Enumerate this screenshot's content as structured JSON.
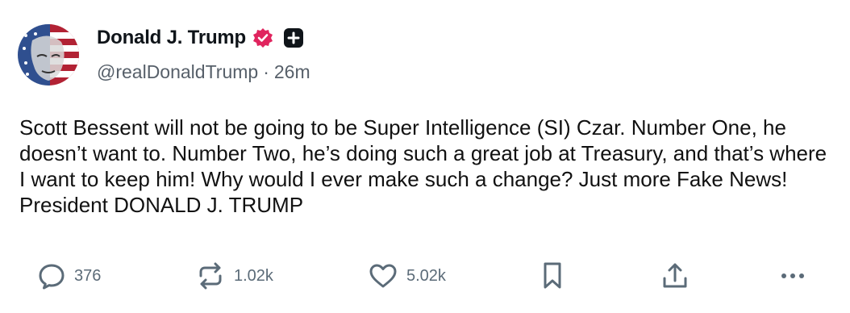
{
  "post": {
    "author": {
      "display_name": "Donald J. Trump",
      "handle": "@realDonaldTrump",
      "verified_icon": "verified-badge-icon",
      "plus_icon": "plus-badge-icon"
    },
    "separator": "·",
    "time_ago": "26m",
    "body": "Scott Bessent will not be going to be Super Intelligence (SI) Czar. Number One, he doesn’t want to. Number Two, he’s doing such a great job at Treasury, and that’s where I want to keep him! Why would I ever make such a change? Just more Fake News! President DONALD J. TRUMP",
    "actions": {
      "reply_count": "376",
      "repost_count": "1.02k",
      "like_count": "5.02k"
    }
  },
  "colors": {
    "verified": "#e0245e",
    "icon_gray": "#5b6b78",
    "handle_gray": "#57606a"
  }
}
